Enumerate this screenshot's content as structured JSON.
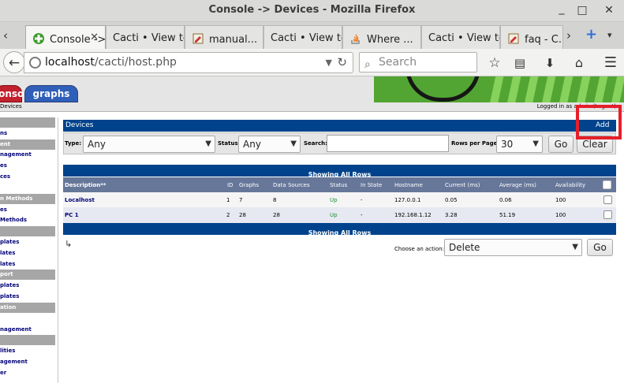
{
  "window": {
    "title": "Console -> Devices - Mozilla Firefox"
  },
  "tabs": [
    {
      "label": "Console -> Devices",
      "icon": "cacti-icon",
      "active": true
    },
    {
      "label": "Cacti • View topic - ..."
    },
    {
      "label": "manual..."
    },
    {
      "label": "Cacti • View topic - ..."
    },
    {
      "label": "Where ..."
    },
    {
      "label": "Cacti • View topic - ..."
    },
    {
      "label": "faq - C..."
    }
  ],
  "nav": {
    "url_host": "localhost",
    "url_path": "/cacti/host.php",
    "search_placeholder": "Search"
  },
  "cacti": {
    "console_tab": "console",
    "graphs_tab": "graphs",
    "breadcrumb": "Devices",
    "logged_in": "Logged in as admin (Logout)"
  },
  "sidebar": [
    {
      "label": "",
      "type": "hdr"
    },
    {
      "label": "ns",
      "type": "item"
    },
    {
      "label": "ent",
      "type": "hdr"
    },
    {
      "label": "nagement",
      "type": "item"
    },
    {
      "label": "es",
      "type": "item"
    },
    {
      "label": "ces",
      "type": "item"
    },
    {
      "label": "",
      "type": "gap"
    },
    {
      "label": "n Methods",
      "type": "hdr"
    },
    {
      "label": "es",
      "type": "item"
    },
    {
      "label": "Methods",
      "type": "item"
    },
    {
      "label": "",
      "type": "hdr"
    },
    {
      "label": "plates",
      "type": "item"
    },
    {
      "label": "lates",
      "type": "item"
    },
    {
      "label": "lates",
      "type": "item"
    },
    {
      "label": "port",
      "type": "hdr"
    },
    {
      "label": "plates",
      "type": "item"
    },
    {
      "label": "plates",
      "type": "item"
    },
    {
      "label": "ation",
      "type": "hdr"
    },
    {
      "label": "",
      "type": "gap"
    },
    {
      "label": "nagement",
      "type": "item"
    },
    {
      "label": "",
      "type": "hdr"
    },
    {
      "label": "lities",
      "type": "item"
    },
    {
      "label": "agement",
      "type": "item"
    },
    {
      "label": "er",
      "type": "item"
    }
  ],
  "devices": {
    "title": "Devices",
    "add_label": "Add",
    "filter": {
      "type_label": "Type:",
      "type_value": "Any",
      "status_label": "Status:",
      "status_value": "Any",
      "search_label": "Search:",
      "search_value": "",
      "rows_label": "Rows per Page:",
      "rows_value": "30",
      "go": "Go",
      "clear": "Clear"
    },
    "showing": "Showing All Rows",
    "columns": [
      "Description**",
      "ID",
      "Graphs",
      "Data Sources",
      "Status",
      "In State",
      "Hostname",
      "Current (ms)",
      "Average (ms)",
      "Availability"
    ],
    "rows": [
      [
        "Localhost",
        "1",
        "7",
        "8",
        "Up",
        "-",
        "127.0.0.1",
        "0.05",
        "0.06",
        "100"
      ],
      [
        "PC 1",
        "2",
        "28",
        "28",
        "Up",
        "-",
        "192.168.1.12",
        "3.28",
        "51.19",
        "100"
      ]
    ],
    "action_label": "Choose an action:",
    "action_value": "Delete",
    "action_go": "Go"
  },
  "colors": {
    "header_blue": "#00438c",
    "status_up": "#198e32",
    "highlight": "#e51f2a"
  }
}
